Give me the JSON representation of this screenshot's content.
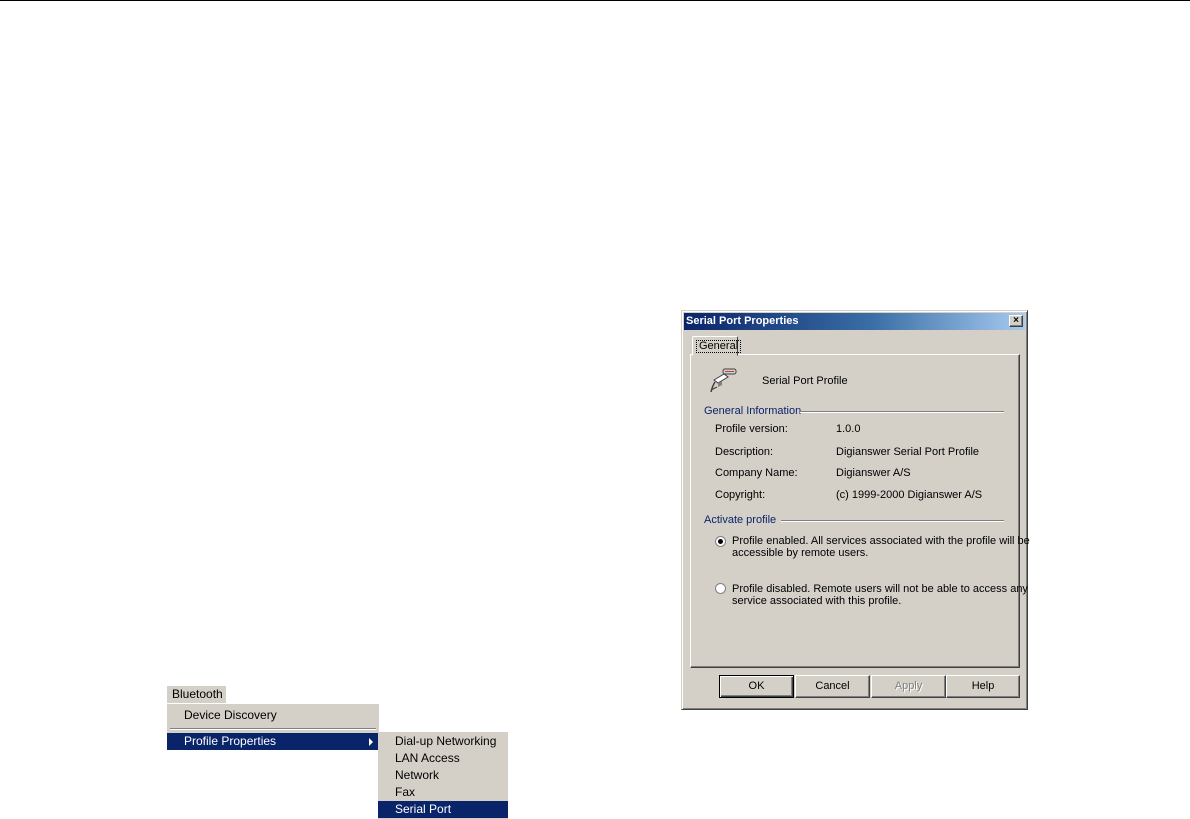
{
  "dialog": {
    "title": "Serial Port Properties",
    "close_glyph": "×",
    "tab_label": "General",
    "profile_name": "Serial Port Profile",
    "general_info": {
      "title": "General Information",
      "rows": [
        {
          "label": "Profile version:",
          "value": "1.0.0"
        },
        {
          "label": "Description:",
          "value": "Digianswer Serial Port Profile"
        },
        {
          "label": "Company Name:",
          "value": "Digianswer A/S"
        },
        {
          "label": "Copyright:",
          "value": "(c) 1999-2000 Digianswer A/S"
        }
      ]
    },
    "activate": {
      "title": "Activate profile",
      "options": [
        {
          "text": "Profile enabled. All services associated with the profile will be accessible by remote users.",
          "checked": true
        },
        {
          "text": "Profile disabled. Remote users will not be able to access any service associated with this profile.",
          "checked": false
        }
      ]
    },
    "buttons": {
      "ok": "OK",
      "cancel": "Cancel",
      "apply": "Apply",
      "help": "Help"
    }
  },
  "menu": {
    "bar_label": "Bluetooth",
    "items": [
      {
        "label": "Device Discovery"
      },
      {
        "label": "Profile Properties",
        "selected": true,
        "has_submenu": true
      }
    ],
    "submenu": [
      {
        "label": "Dial-up Networking"
      },
      {
        "label": "LAN Access"
      },
      {
        "label": "Network"
      },
      {
        "label": "Fax"
      },
      {
        "label": "Serial Port",
        "selected": true
      }
    ]
  },
  "colors": {
    "face": "#d4d0c8",
    "selection": "#0a246a",
    "title_gradient_end": "#a6caf0",
    "group_title": "#0a246a"
  },
  "icons": {
    "profile": "serial-port-icon",
    "submenu": "submenu-arrow-icon",
    "close": "close-icon"
  }
}
